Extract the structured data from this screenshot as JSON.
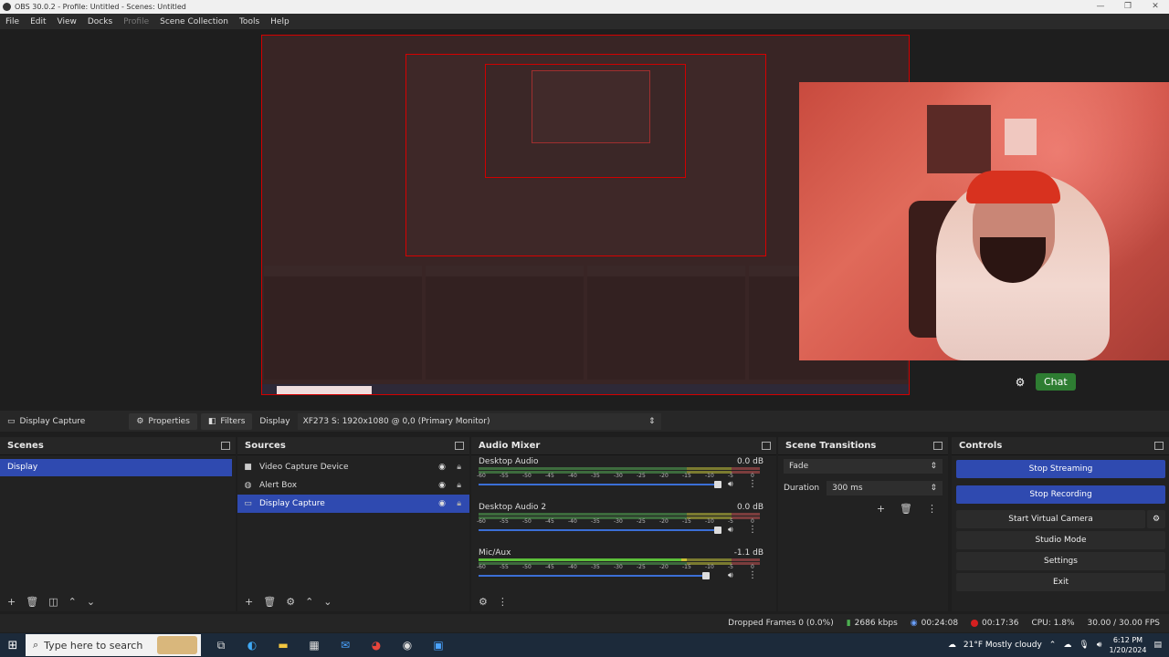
{
  "window": {
    "title": "OBS 30.0.2 - Profile: Untitled - Scenes: Untitled",
    "controls": [
      "—",
      "❐",
      "✕"
    ]
  },
  "menu": [
    "File",
    "Edit",
    "View",
    "Docks",
    "Profile",
    "Scene Collection",
    "Tools",
    "Help"
  ],
  "overlay": {
    "chat_label": "Chat"
  },
  "source_bar": {
    "selected_source": "Display Capture",
    "properties_label": "Properties",
    "filters_label": "Filters",
    "display_label": "Display",
    "display_value": "XF273 S: 1920x1080 @ 0,0 (Primary Monitor)"
  },
  "scenes": {
    "title": "Scenes",
    "items": [
      "Display"
    ]
  },
  "sources": {
    "title": "Sources",
    "items": [
      {
        "name": "Video Capture Device",
        "icon": "camera-icon"
      },
      {
        "name": "Alert Box",
        "icon": "browser-icon"
      },
      {
        "name": "Display Capture",
        "icon": "monitor-icon"
      }
    ]
  },
  "mixer": {
    "title": "Audio Mixer",
    "ticks": [
      "-60",
      "-55",
      "-50",
      "-45",
      "-40",
      "-35",
      "-30",
      "-25",
      "-20",
      "-15",
      "-10",
      "-5",
      "0"
    ],
    "channels": [
      {
        "name": "Desktop Audio",
        "db": "0.0 dB",
        "level": 0.0,
        "volume": 0.85
      },
      {
        "name": "Desktop Audio 2",
        "db": "0.0 dB",
        "level": 0.0,
        "volume": 0.85
      },
      {
        "name": "Mic/Aux",
        "db": "-1.1 dB",
        "level": 0.72,
        "volume": 0.81
      }
    ]
  },
  "transitions": {
    "title": "Scene Transitions",
    "type": "Fade",
    "duration_label": "Duration",
    "duration_value": "300 ms"
  },
  "controls": {
    "title": "Controls",
    "stop_streaming": "Stop Streaming",
    "stop_recording": "Stop Recording",
    "start_virtual_camera": "Start Virtual Camera",
    "studio_mode": "Studio Mode",
    "settings": "Settings",
    "exit": "Exit"
  },
  "status": {
    "dropped_frames": "Dropped Frames 0 (0.0%)",
    "bitrate": "2686 kbps",
    "stream_time": "00:24:08",
    "rec_time": "00:17:36",
    "cpu": "CPU: 1.8%",
    "fps": "30.00 / 30.00 FPS"
  },
  "taskbar": {
    "search_placeholder": "Type here to search",
    "weather": "21°F  Mostly cloudy",
    "time": "6:12 PM",
    "date": "1/20/2024"
  },
  "colors": {
    "accent": "#2f4ab0",
    "record_red": "#d42020",
    "preview_border": "#d40000",
    "chat_green": "#2e7d32"
  }
}
